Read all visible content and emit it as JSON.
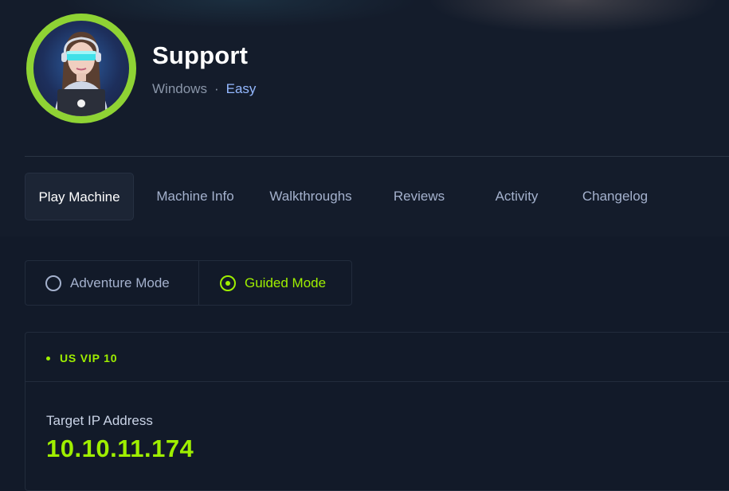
{
  "machine": {
    "name": "Support",
    "os": "Windows",
    "separator": "·",
    "difficulty": "Easy"
  },
  "colors": {
    "accent": "#9fef00",
    "avatar_ring": "#8fd334",
    "difficulty_easy": "#94b8ff",
    "background": "#121a29"
  },
  "tabs": [
    {
      "label": "Play Machine",
      "active": true
    },
    {
      "label": "Machine Info",
      "active": false
    },
    {
      "label": "Walkthroughs",
      "active": false
    },
    {
      "label": "Reviews",
      "active": false
    },
    {
      "label": "Activity",
      "active": false
    },
    {
      "label": "Changelog",
      "active": false
    }
  ],
  "modes": {
    "adventure": {
      "label": "Adventure Mode",
      "selected": false
    },
    "guided": {
      "label": "Guided Mode",
      "selected": true
    }
  },
  "connection": {
    "server": "US VIP 10",
    "ip_label": "Target IP Address",
    "ip_value": "10.10.11.174"
  },
  "icons": {
    "avatar": "machine-avatar-icon",
    "radio_off": "radio-unchecked-icon",
    "radio_on": "radio-checked-icon",
    "status": "status-dot-icon"
  }
}
